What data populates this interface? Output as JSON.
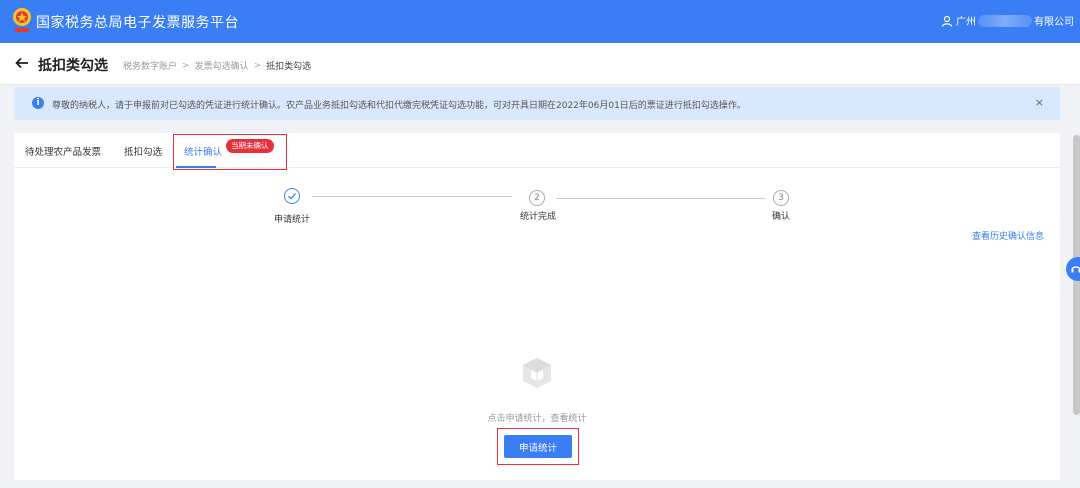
{
  "header": {
    "app_title": "国家税务总局电子发票服务平台",
    "user_prefix": "广州",
    "user_suffix": "有限公司"
  },
  "breadcrumb": {
    "page_title": "抵扣类勾选",
    "items": [
      "税务数字账户",
      "发票勾选确认",
      "抵扣类勾选"
    ],
    "separator": ">"
  },
  "notice": {
    "icon": "i",
    "text": "尊敬的纳税人，请于申报前对已勾选的凭证进行统计确认。农产品业务抵扣勾选和代扣代缴完税凭证勾选功能，可对开具日期在2022年06月01日后的票证进行抵扣勾选操作。",
    "close": "×"
  },
  "tabs": [
    {
      "label": "待处理农产品发票"
    },
    {
      "label": "抵扣勾选"
    },
    {
      "label": "统计确认",
      "badge": "当期未确认"
    }
  ],
  "steps": [
    {
      "number": "",
      "label": "申请统计",
      "done": true
    },
    {
      "number": "2",
      "label": "统计完成",
      "done": false
    },
    {
      "number": "3",
      "label": "确认",
      "done": false
    }
  ],
  "history_link": "查看历史确认信息",
  "empty": {
    "text": "点击申请统计，查看统计",
    "button": "申请统计"
  },
  "colors": {
    "primary": "#3a7ef5",
    "danger": "#e8303a",
    "notice_bg": "#d9e9fd"
  }
}
